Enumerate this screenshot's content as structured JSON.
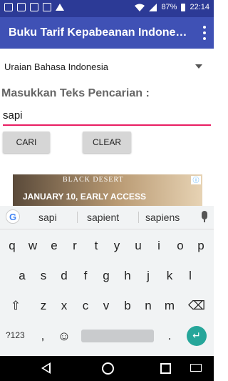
{
  "status_bar": {
    "battery": "87%",
    "time": "22:14",
    "icons": [
      "notification-box-icon",
      "message-icon",
      "mail-icon",
      "image-icon",
      "alert-icon",
      "wifi-icon",
      "signal-icon",
      "battery-icon"
    ]
  },
  "app_bar": {
    "title": "Buku Tarif Kepabeanan Indonesia",
    "menu_icon": "overflow-menu-icon",
    "color": "#3f51b5"
  },
  "spinner": {
    "selected": "Uraian Bahasa Indonesia"
  },
  "search": {
    "prompt": "Masukkan Teks Pencarian :",
    "value": "sapi",
    "accent": "#e91e63"
  },
  "buttons": {
    "cari": "CARI",
    "clear": "CLEAR"
  },
  "ad": {
    "brand": "BLACK DESERT",
    "headline": "JANUARY 10, EARLY ACCESS"
  },
  "keyboard": {
    "suggestions": [
      "sapi",
      "sapient",
      "sapiens"
    ],
    "row1": [
      "q",
      "w",
      "e",
      "r",
      "t",
      "y",
      "u",
      "i",
      "o",
      "p"
    ],
    "row2": [
      "a",
      "s",
      "d",
      "f",
      "g",
      "h",
      "j",
      "k",
      "l"
    ],
    "row3": [
      "z",
      "x",
      "c",
      "v",
      "b",
      "n",
      "m"
    ],
    "symbols_label": "?123",
    "comma": ",",
    "period": ".",
    "emoji_icon": "emoji-icon",
    "shift_icon": "shift-icon",
    "backspace_icon": "backspace-icon",
    "enter_icon": "enter-icon",
    "enter_color": "#26a69a"
  }
}
